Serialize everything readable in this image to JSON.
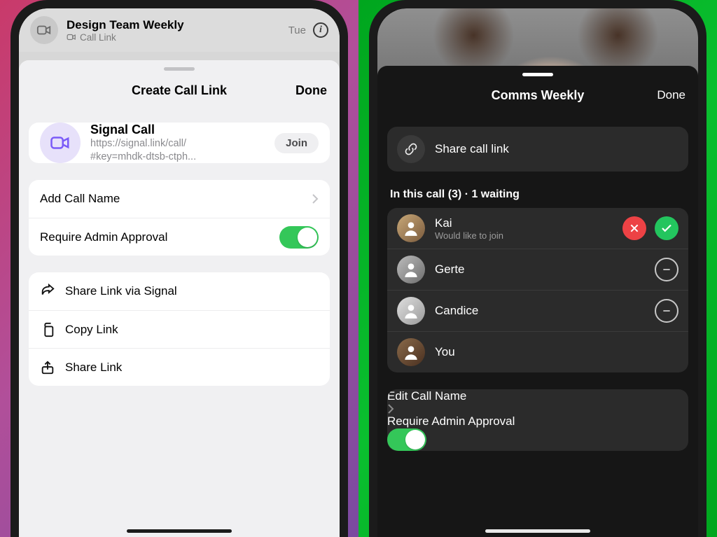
{
  "left": {
    "chat": {
      "title": "Design Team Weekly",
      "subtitle": "Call Link",
      "time": "Tue"
    },
    "sheet_title": "Create Call Link",
    "done": "Done",
    "signal": {
      "title": "Signal Call",
      "url_line1": "https://signal.link/call/",
      "url_line2": "#key=mhdk-dtsb-ctph...",
      "join": "Join"
    },
    "settings": {
      "add_name": "Add Call Name",
      "require_admin": "Require Admin Approval",
      "require_admin_on": true
    },
    "share": {
      "via_signal": "Share Link via Signal",
      "copy": "Copy Link",
      "share": "Share Link"
    }
  },
  "right": {
    "sheet_title": "Comms Weekly",
    "done": "Done",
    "share_row": "Share call link",
    "section": "In this call (3) · 1 waiting",
    "people": [
      {
        "name": "Kai",
        "status": "Would like to join",
        "waiting": true
      },
      {
        "name": "Gerte",
        "removable": true
      },
      {
        "name": "Candice",
        "removable": true
      },
      {
        "name": "You"
      }
    ],
    "edit_name": "Edit Call Name",
    "require_admin": "Require Admin Approval",
    "require_admin_on": true
  }
}
